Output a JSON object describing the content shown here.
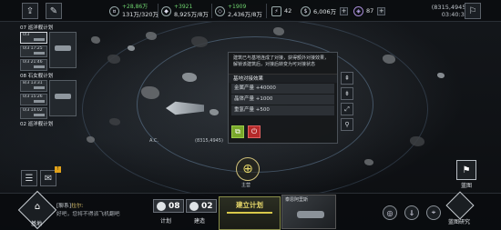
{
  "topbar": {
    "resources": [
      {
        "icon": "credit-icon",
        "delta": "+28,86万",
        "amount": "131万/320万"
      },
      {
        "icon": "metal-icon",
        "delta": "+3921",
        "amount": "8,925万/8万"
      },
      {
        "icon": "crystal-icon",
        "delta": "+1909",
        "amount": "2,436万/8万"
      }
    ],
    "power": "42",
    "currency": "6,006万",
    "gems": "87",
    "coords": "(8315,4945)",
    "time": "03:40:35"
  },
  "fleets": {
    "group1": {
      "header": "07 巡洋舰计划",
      "cards": [
        "0/3",
        "0/3 17:25",
        "0/3 21:46"
      ]
    },
    "group2": {
      "header": "08 石女舰计划",
      "cards": [
        "8/3 13:31",
        "0/3 15:26",
        "0/3 14:02"
      ]
    },
    "group3": {
      "header": "02 巡洋舰计划"
    }
  },
  "popup": {
    "description": "建筑已与基地连成了对接，获得额外对接效果，解锁该建筑后，对接后转变为可对接状态",
    "title": "基地对接效果",
    "effects": [
      "金属产量 +40000",
      "晶体产量 +1000",
      "重氢产量 +500"
    ]
  },
  "map": {
    "fleet_label": "A.C.",
    "coord_label": "(8315,4945)",
    "marker_label": "主营"
  },
  "bottom": {
    "base_label": "基地",
    "chat_tag": "[聊系]",
    "chat_name": "拉尔:",
    "chat_msg": "好吧，您将不得派飞机翻吧",
    "plan_count": "08",
    "plan_label": "计划",
    "build_count": "02",
    "build_label": "建造",
    "build_plan_label": "建立计划",
    "thumb_label": "泰恩阿里斯",
    "research_label": "蓝图研究",
    "flagship_label": "蓝图"
  },
  "colors": {
    "accent": "#e7d86a",
    "confirm": "#7aa82c",
    "cancel": "#b52a2a"
  }
}
